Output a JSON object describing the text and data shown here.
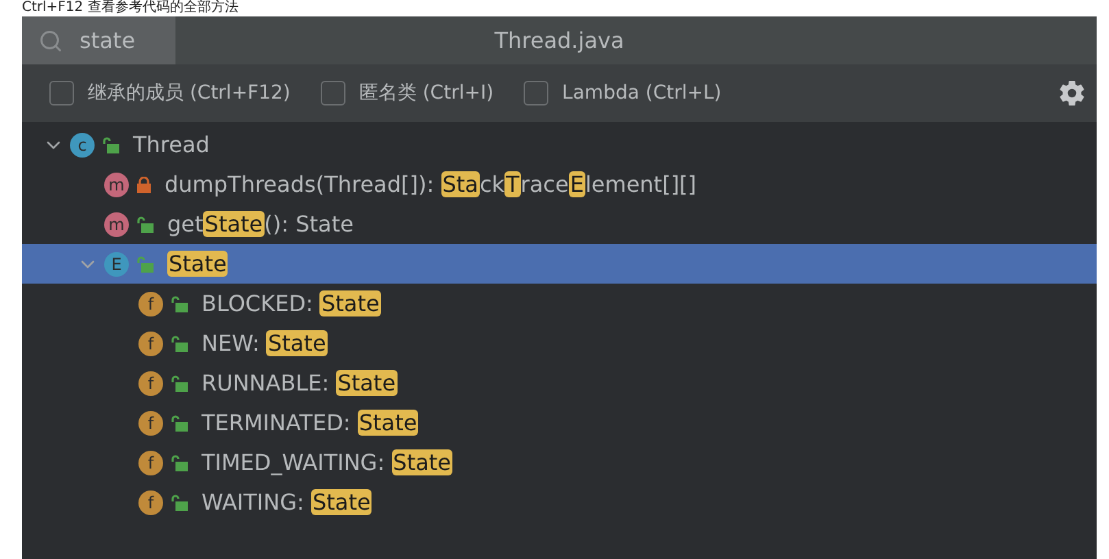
{
  "caption": "Ctrl+F12 查看参考代码的全部方法",
  "search": {
    "value": "state"
  },
  "title": "Thread.java",
  "filters": [
    {
      "label": "继承的成员 (Ctrl+F12)",
      "checked": false
    },
    {
      "label": "匿名类 (Ctrl+I)",
      "checked": false
    },
    {
      "label": "Lambda (Ctrl+L)",
      "checked": false
    }
  ],
  "tree": [
    {
      "kind": "class",
      "letter": "c",
      "locked": false,
      "expanded": true,
      "selected": false,
      "parts": [
        {
          "text": "Thread",
          "highlight": false
        }
      ],
      "children": [
        {
          "kind": "method",
          "letter": "m",
          "locked": true,
          "selected": false,
          "parts": [
            {
              "text": "dumpThreads(Thread[]): ",
              "highlight": false
            },
            {
              "text": "Sta",
              "highlight": true
            },
            {
              "text": "ck",
              "highlight": false
            },
            {
              "text": "T",
              "highlight": true
            },
            {
              "text": "race",
              "highlight": false
            },
            {
              "text": "E",
              "highlight": true
            },
            {
              "text": "lement[][]",
              "highlight": false
            }
          ]
        },
        {
          "kind": "method",
          "letter": "m",
          "locked": false,
          "selected": false,
          "parts": [
            {
              "text": "get",
              "highlight": false
            },
            {
              "text": "State",
              "highlight": true
            },
            {
              "text": "(): State",
              "highlight": false
            }
          ]
        },
        {
          "kind": "enum",
          "letter": "E",
          "locked": false,
          "expanded": true,
          "selected": true,
          "parts": [
            {
              "text": "State",
              "highlight": true
            }
          ],
          "children": [
            {
              "kind": "field",
              "letter": "f",
              "locked": false,
              "selected": false,
              "parts": [
                {
                  "text": "BLOCKED: ",
                  "highlight": false
                },
                {
                  "text": "State",
                  "highlight": true
                }
              ]
            },
            {
              "kind": "field",
              "letter": "f",
              "locked": false,
              "selected": false,
              "parts": [
                {
                  "text": "NEW: ",
                  "highlight": false
                },
                {
                  "text": "State",
                  "highlight": true
                }
              ]
            },
            {
              "kind": "field",
              "letter": "f",
              "locked": false,
              "selected": false,
              "parts": [
                {
                  "text": "RUNNABLE: ",
                  "highlight": false
                },
                {
                  "text": "State",
                  "highlight": true
                }
              ]
            },
            {
              "kind": "field",
              "letter": "f",
              "locked": false,
              "selected": false,
              "parts": [
                {
                  "text": "TERMINATED: ",
                  "highlight": false
                },
                {
                  "text": "State",
                  "highlight": true
                }
              ]
            },
            {
              "kind": "field",
              "letter": "f",
              "locked": false,
              "selected": false,
              "parts": [
                {
                  "text": "TIMED_WAITING: ",
                  "highlight": false
                },
                {
                  "text": "State",
                  "highlight": true
                }
              ]
            },
            {
              "kind": "field",
              "letter": "f",
              "locked": false,
              "selected": false,
              "parts": [
                {
                  "text": "WAITING: ",
                  "highlight": false
                },
                {
                  "text": "State",
                  "highlight": true
                }
              ]
            }
          ]
        }
      ]
    }
  ]
}
